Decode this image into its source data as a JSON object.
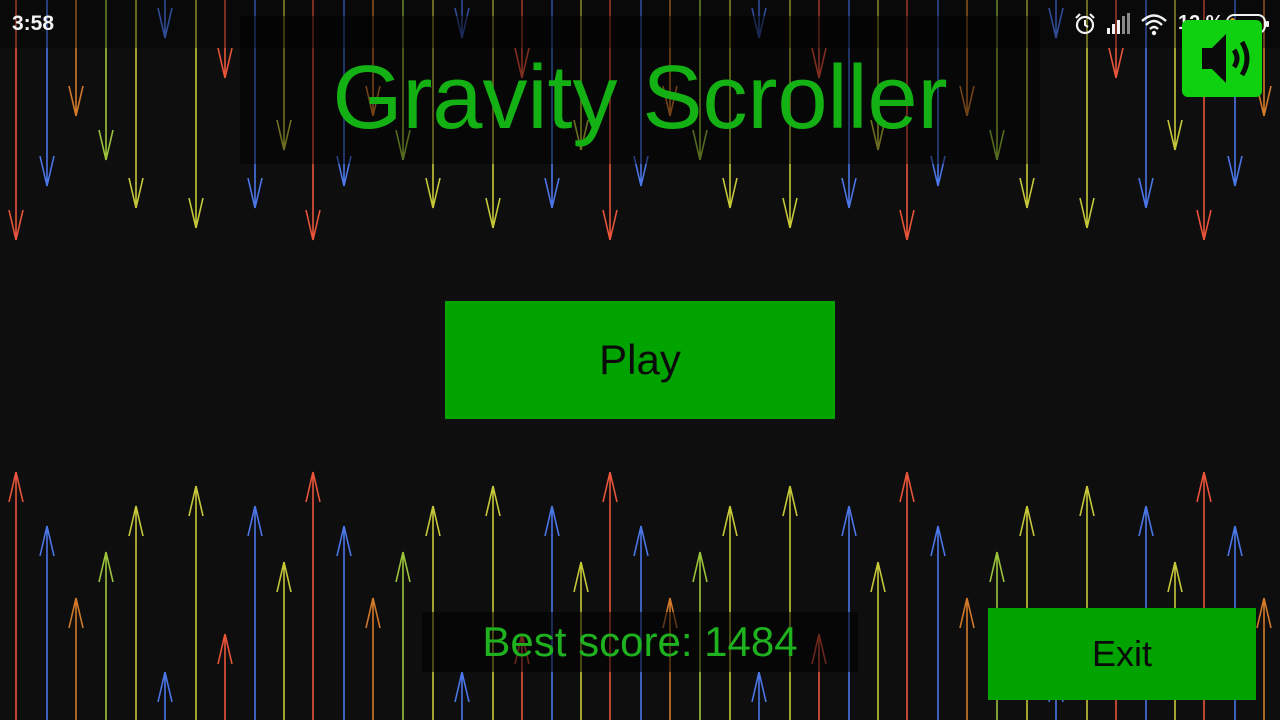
{
  "status_bar": {
    "time": "3:58",
    "battery_percent": "12 %",
    "icons": [
      "alarm-icon",
      "signal-icon",
      "wifi-icon",
      "battery-icon"
    ]
  },
  "game": {
    "title": "Gravity Scroller",
    "play_label": "Play",
    "best_score_label": "Best score: 1484",
    "exit_label": "Exit",
    "sound_icon": "speaker-on-icon"
  },
  "colors": {
    "background": "#0e0e0e",
    "title_green": "#13b113",
    "button_green": "#00a300",
    "sound_button_green": "#10d110",
    "arrow_red": "#e8553a",
    "arrow_blue": "#4a76e8",
    "arrow_yellow": "#c6c83a",
    "arrow_orange": "#d27a2a",
    "arrow_lime": "#9cc43a"
  }
}
